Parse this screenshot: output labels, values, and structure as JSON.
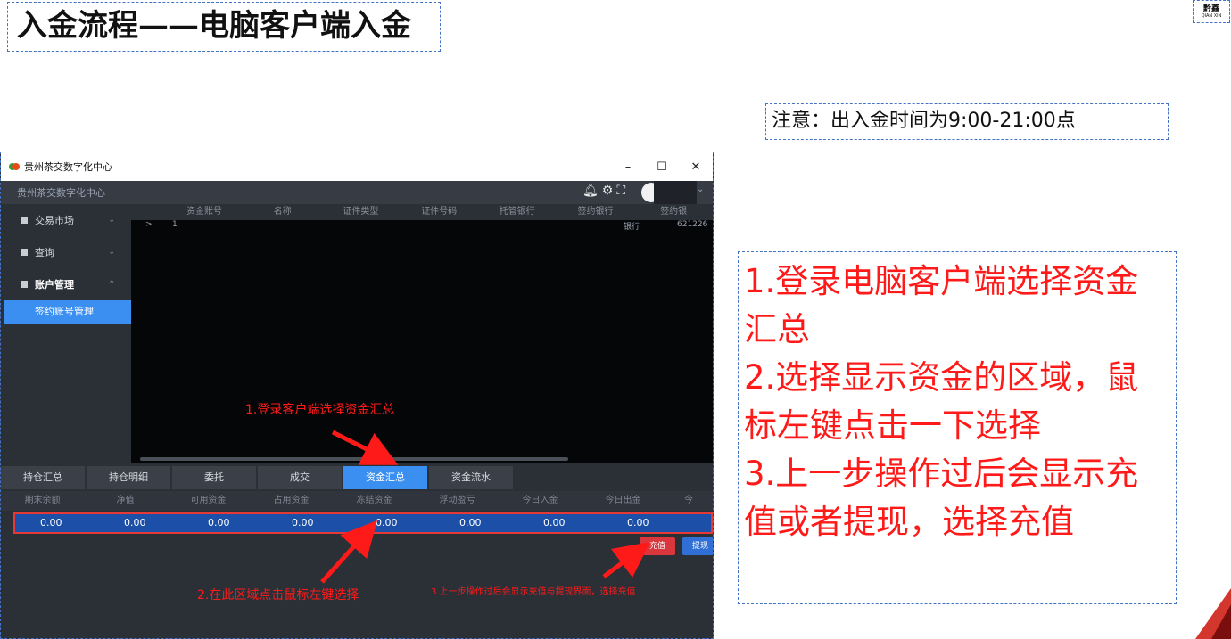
{
  "slide": {
    "title": "入金流程——电脑客户端入金",
    "notice": "注意：出入金时间为9:00-21:00点",
    "logo": {
      "name": "黔鑫",
      "sub": "QIAN XIN"
    },
    "steps": [
      "1.登录电脑客户端选择资金汇总",
      "2.选择显示资金的区域，鼠标左键点击一下选择",
      "3.上一步操作过后会显示充值或者提现，选择充值"
    ]
  },
  "app": {
    "window_title": "贵州茶交数字化中心",
    "header_title": "贵州茶交数字化中心",
    "window_controls": [
      "–",
      "☐",
      "✕"
    ],
    "sidebar": [
      {
        "label": "交易市场",
        "chevron": "⌄"
      },
      {
        "label": "查询",
        "chevron": "⌄"
      },
      {
        "label": "账户管理",
        "chevron": "⌃"
      }
    ],
    "sidebar_sub": "签约账号管理",
    "top_grid": {
      "columns": [
        "资金账号",
        "名称",
        "证件类型",
        "证件号码",
        "托管银行",
        "签约银行",
        "签约银"
      ],
      "row_fragments": [
        ">",
        "1",
        "银行",
        "621226"
      ]
    },
    "annotations": {
      "a1": "1.登录客户端选择资金汇总",
      "a2": "2.在此区域点击鼠标左键选择",
      "a3": "3.上一步操作过后会显示充值与提现界面，选择充值"
    },
    "tabs": [
      "持仓汇总",
      "持仓明细",
      "委托",
      "成交",
      "资金汇总",
      "资金流水"
    ],
    "active_tab": 4,
    "fund_columns": [
      "期末余额",
      "净值",
      "可用资金",
      "占用资金",
      "冻结资金",
      "浮动盈亏",
      "今日入金",
      "今日出金",
      "今"
    ],
    "fund_values": [
      "0.00",
      "0.00",
      "0.00",
      "0.00",
      "0.00",
      "0.00",
      "0.00",
      "0.00"
    ],
    "buttons": {
      "recharge": "充值",
      "withdraw": "提现"
    }
  },
  "colors": {
    "accent_blue": "#3b8ff0",
    "annotation_red": "#ff1a1a",
    "border_dashed": "#4472c4"
  }
}
